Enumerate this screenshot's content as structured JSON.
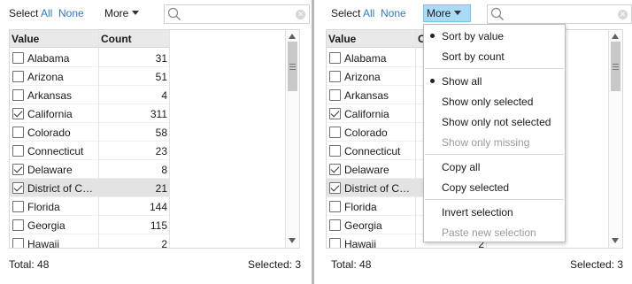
{
  "toolbar": {
    "select_label": "Select",
    "all_label": "All",
    "none_label": "None",
    "more_label": "More"
  },
  "table": {
    "col_value": "Value",
    "col_count": "Count",
    "rows": [
      {
        "value": "Alabama",
        "count": "31",
        "checked": false,
        "highlight": false
      },
      {
        "value": "Arizona",
        "count": "51",
        "checked": false,
        "highlight": false
      },
      {
        "value": "Arkansas",
        "count": "4",
        "checked": false,
        "highlight": false
      },
      {
        "value": "California",
        "count": "311",
        "checked": true,
        "highlight": false
      },
      {
        "value": "Colorado",
        "count": "58",
        "checked": false,
        "highlight": false
      },
      {
        "value": "Connecticut",
        "count": "23",
        "checked": false,
        "highlight": false
      },
      {
        "value": "Delaware",
        "count": "8",
        "checked": true,
        "highlight": false
      },
      {
        "value": "District of Columbia",
        "count": "21",
        "checked": true,
        "highlight": true
      },
      {
        "value": "Florida",
        "count": "144",
        "checked": false,
        "highlight": false
      },
      {
        "value": "Georgia",
        "count": "115",
        "checked": false,
        "highlight": false
      },
      {
        "value": "Hawaii",
        "count": "2",
        "checked": false,
        "highlight": false
      }
    ]
  },
  "footer": {
    "total": "Total: 48",
    "selected": "Selected: 3"
  },
  "menu": {
    "sort_value": "Sort by value",
    "sort_count": "Sort by count",
    "show_all": "Show all",
    "show_selected": "Show only selected",
    "show_not_selected": "Show only not selected",
    "show_missing": "Show only missing",
    "copy_all": "Copy all",
    "copy_selected": "Copy selected",
    "invert": "Invert selection",
    "paste": "Paste new selection"
  },
  "colors": {
    "link": "#2f78d3",
    "active_button": "#a9dbf7",
    "row_highlight": "#e3e3e3"
  }
}
